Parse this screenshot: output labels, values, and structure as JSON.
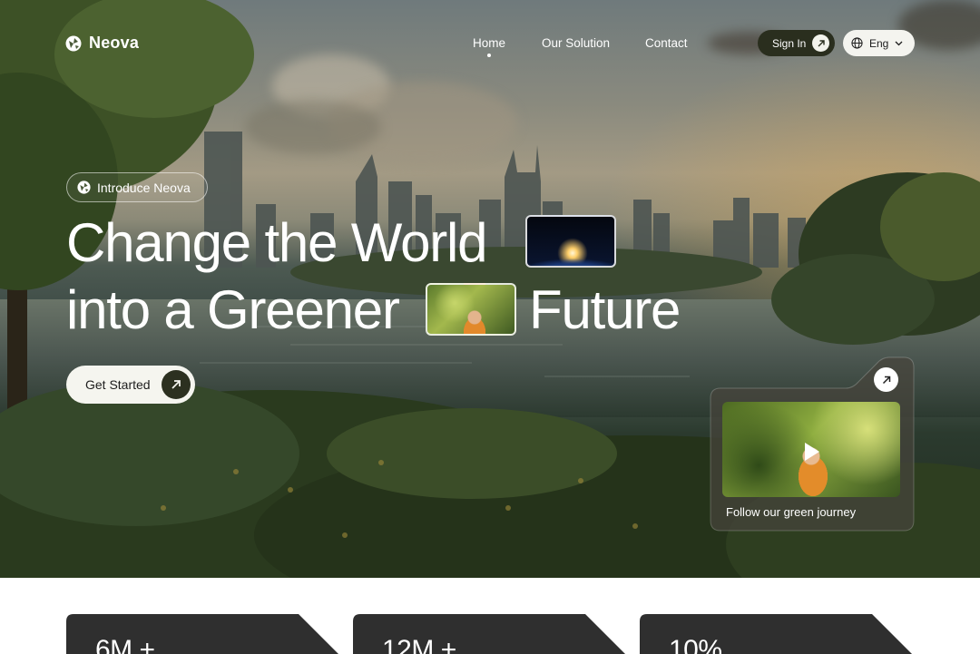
{
  "brand": {
    "name": "Neova"
  },
  "nav": {
    "links": [
      {
        "label": "Home",
        "active": true
      },
      {
        "label": "Our Solution",
        "active": false
      },
      {
        "label": "Contact",
        "active": false
      }
    ],
    "signin_label": "Sign In",
    "language_label": "Eng"
  },
  "hero": {
    "badge_label": "Introduce Neova",
    "headline_line1": "Change the World",
    "headline_line2_start": "into a Greener",
    "headline_line2_end": "Future",
    "cta_label": "Get Started"
  },
  "video_card": {
    "caption": "Follow our green journey"
  },
  "stats": [
    {
      "value": "6M +"
    },
    {
      "value": "12M +"
    },
    {
      "value": "10%"
    }
  ],
  "colors": {
    "accent_dark": "#2a2e1e",
    "light_pill": "#f4f4ef",
    "stat_card": "#2f2f2f"
  },
  "icons": [
    "logo-icon",
    "arrow-up-right-icon",
    "globe-icon",
    "chevron-down-icon",
    "play-icon"
  ]
}
